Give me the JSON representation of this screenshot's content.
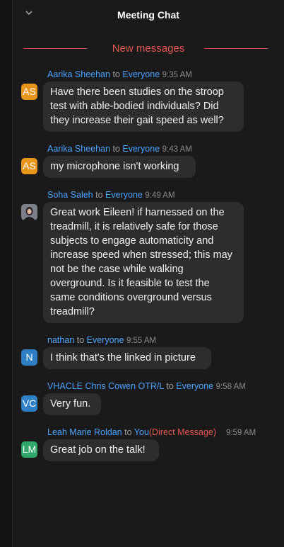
{
  "header": {
    "title": "Meeting Chat",
    "collapse_icon": "chevron-down-icon"
  },
  "divider": {
    "label": "New messages"
  },
  "messages": [
    {
      "sender": "Aarika Sheehan",
      "to_word": "to",
      "target": "Everyone",
      "dm": "",
      "time": "9:35 AM",
      "initials": "AS",
      "avatar_color": "#e8951c",
      "text": "Have there been studies on the stroop test with able-bodied individuals? Did they increase their gait speed as well?"
    },
    {
      "sender": "Aarika Sheehan",
      "to_word": "to",
      "target": "Everyone",
      "dm": "",
      "time": "9:43 AM",
      "initials": "AS",
      "avatar_color": "#e8951c",
      "text": "my microphone isn't working"
    },
    {
      "sender": "Soha Saleh",
      "to_word": "to",
      "target": "Everyone",
      "dm": "",
      "time": "9:49 AM",
      "initials": "",
      "avatar_color": "#6b6f7a",
      "text": "Great work Eileen! if harnessed on the treadmill, it is relatively safe for those subjects to engage automaticity and increase speed when stressed; this may not be the case while walking overground. Is it feasible to test the same conditions overground versus treadmill?"
    },
    {
      "sender": "nathan",
      "to_word": "to",
      "target": "Everyone",
      "dm": "",
      "time": "9:55 AM",
      "initials": "N",
      "avatar_color": "#2f7fc4",
      "text": "I think that's the linked in picture"
    },
    {
      "sender": "VHACLE Chris Cowen OTR/L",
      "to_word": "to",
      "target": "Everyone",
      "dm": "",
      "time": "9:58 AM",
      "initials": "VC",
      "avatar_color": "#2f7fc4",
      "text": "Very fun."
    },
    {
      "sender": "Leah Marie Roldan",
      "to_word": "to",
      "target": "You",
      "dm": "(Direct Message)",
      "time": "9:59 AM",
      "initials": "LM",
      "avatar_color": "#2fa86a",
      "text": "Great job on the talk!"
    }
  ]
}
